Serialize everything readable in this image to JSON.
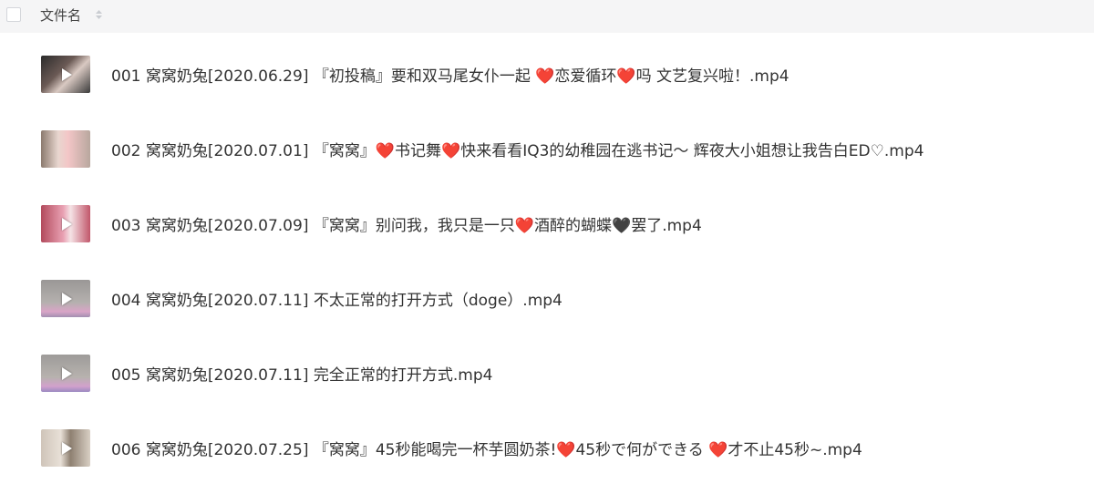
{
  "header": {
    "column_title": "文件名"
  },
  "files": [
    {
      "name": "001 窝窝奶兔[2020.06.29] 『初投稿』要和双马尾女仆一起 ❤️恋爱循环❤️吗 文艺复兴啦！.mp4",
      "thumb_icon": "video-thumbnail"
    },
    {
      "name": "002 窝窝奶兔[2020.07.01] 『窝窝』❤️书记舞❤️快来看看IQ3的幼稚园在逃书记～  辉夜大小姐想让我告白ED♡.mp4",
      "thumb_icon": "video-thumbnail"
    },
    {
      "name": "003 窝窝奶兔[2020.07.09] 『窝窝』别问我，我只是一只❤️酒醉的蝴蝶🖤罢了.mp4",
      "thumb_icon": "video-thumbnail"
    },
    {
      "name": "004 窝窝奶兔[2020.07.11] 不太正常的打开方式（doge）.mp4",
      "thumb_icon": "video-thumbnail"
    },
    {
      "name": "005 窝窝奶兔[2020.07.11] 完全正常的打开方式.mp4",
      "thumb_icon": "video-thumbnail"
    },
    {
      "name": "006 窝窝奶兔[2020.07.25] 『窝窝』45秒能喝完一杯芋圆奶茶!❤️45秒で何ができる ❤️才不止45秒~.mp4",
      "thumb_icon": "video-thumbnail"
    }
  ],
  "colors": {
    "header_bg": "#f5f5f6",
    "text": "#333333"
  }
}
